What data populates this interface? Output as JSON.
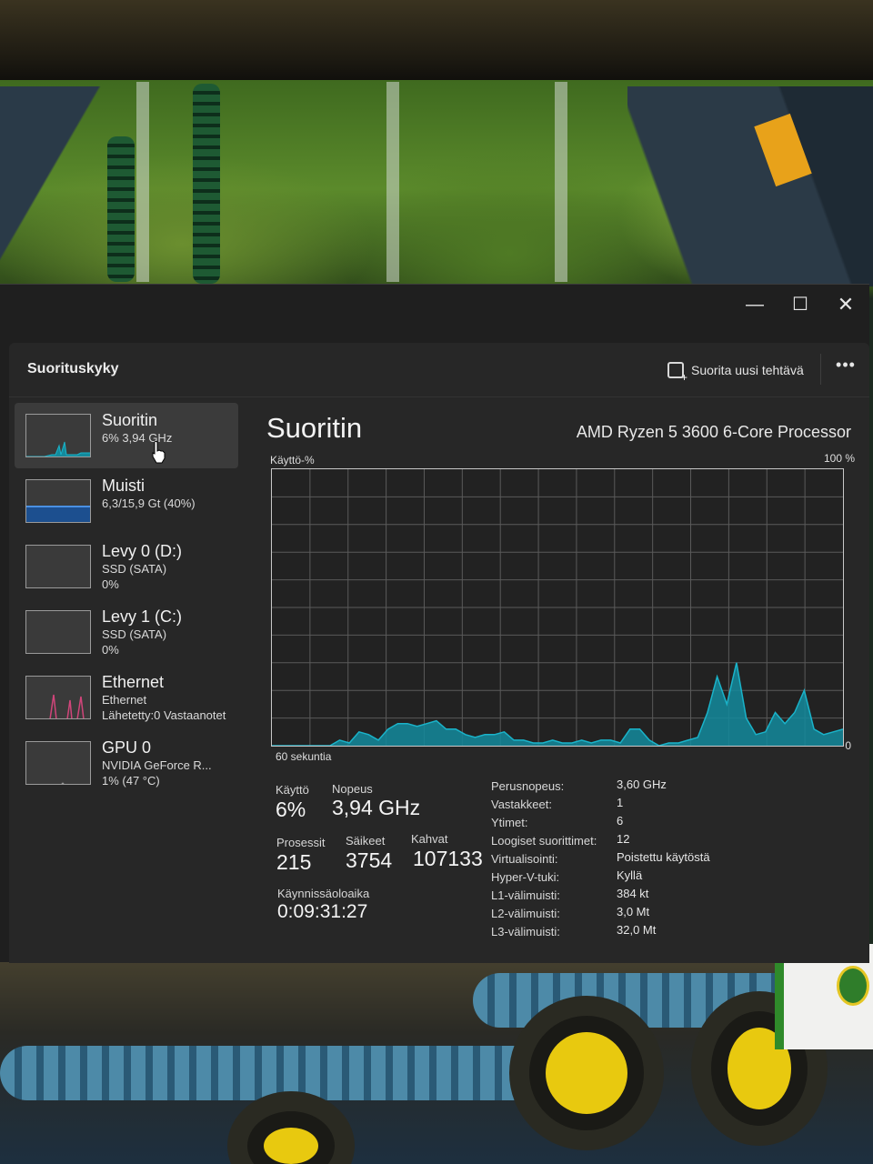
{
  "window": {
    "minimize_glyph": "—",
    "maximize_glyph": "☐",
    "close_glyph": "✕"
  },
  "header": {
    "title": "Suorituskyky",
    "run_task_label": "Suorita uusi tehtävä",
    "more_glyph": "•••"
  },
  "sidebar": {
    "items": [
      {
        "name": "Suoritin",
        "line1": "6% 3,94 GHz",
        "line2": "",
        "line3": "",
        "selected": true,
        "icon": "cpu-graph"
      },
      {
        "name": "Muisti",
        "line1": "6,3/15,9 Gt (40%)",
        "line2": "",
        "line3": "",
        "selected": false,
        "icon": "memory-graph"
      },
      {
        "name": "Levy 0 (D:)",
        "line1": "SSD (SATA)",
        "line2": "0%",
        "line3": "",
        "selected": false,
        "icon": "disk-graph"
      },
      {
        "name": "Levy 1 (C:)",
        "line1": "SSD (SATA)",
        "line2": "0%",
        "line3": "",
        "selected": false,
        "icon": "disk-graph"
      },
      {
        "name": "Ethernet",
        "line1": "Ethernet",
        "line2": "Lähetetty:0 Vastaanotet",
        "line3": "",
        "selected": false,
        "icon": "network-graph"
      },
      {
        "name": "GPU 0",
        "line1": "NVIDIA GeForce R...",
        "line2": "1% (47 °C)",
        "line3": "",
        "selected": false,
        "icon": "gpu-graph"
      }
    ]
  },
  "main": {
    "title": "Suoritin",
    "model": "AMD Ryzen 5 3600 6-Core Processor",
    "axis_y_label": "Käyttö-%",
    "axis_y_max": "100 %",
    "axis_x_label": "60 sekuntia",
    "axis_y_min": "0",
    "stats": {
      "usage_label": "Käyttö",
      "usage_value": "6%",
      "speed_label": "Nopeus",
      "speed_value": "3,94 GHz",
      "processes_label": "Prosessit",
      "processes_value": "215",
      "threads_label": "Säikeet",
      "threads_value": "3754",
      "handles_label": "Kahvat",
      "handles_value": "107133",
      "uptime_label": "Käynnissäoloaika",
      "uptime_value": "0:09:31:27"
    },
    "specs": [
      {
        "key": "Perusnopeus:",
        "value": "3,60 GHz"
      },
      {
        "key": "Vastakkeet:",
        "value": "1"
      },
      {
        "key": "Ytimet:",
        "value": "6"
      },
      {
        "key": "Loogiset suorittimet:",
        "value": "12"
      },
      {
        "key": "Virtualisointi:",
        "value": "Poistettu käytöstä"
      },
      {
        "key": "Hyper-V-tuki:",
        "value": "Kyllä"
      },
      {
        "key": "L1-välimuisti:",
        "value": "384 kt"
      },
      {
        "key": "L2-välimuisti:",
        "value": "3,0 Mt"
      },
      {
        "key": "L3-välimuisti:",
        "value": "32,0 Mt"
      }
    ]
  },
  "colors": {
    "cpu_line": "#1ab3c9",
    "cpu_fill": "#138a9c",
    "memory_fill": "#1c4f8f",
    "network_line": "#d0457a",
    "grid": "#5a5a5a"
  },
  "chart_data": {
    "type": "area",
    "ylim": [
      0,
      100
    ],
    "x_label": "60 sekuntia",
    "y_label": "Käyttö-%",
    "values": [
      0,
      0,
      0,
      0,
      0,
      0,
      0,
      2,
      1,
      5,
      4,
      2,
      6,
      8,
      8,
      7,
      8,
      9,
      6,
      6,
      4,
      3,
      4,
      4,
      5,
      2,
      2,
      1,
      1,
      2,
      1,
      1,
      2,
      1,
      2,
      2,
      1,
      6,
      6,
      2,
      0,
      1,
      1,
      2,
      3,
      12,
      25,
      15,
      30,
      10,
      4,
      5,
      12,
      8,
      12,
      20,
      6,
      4,
      5,
      6
    ]
  }
}
